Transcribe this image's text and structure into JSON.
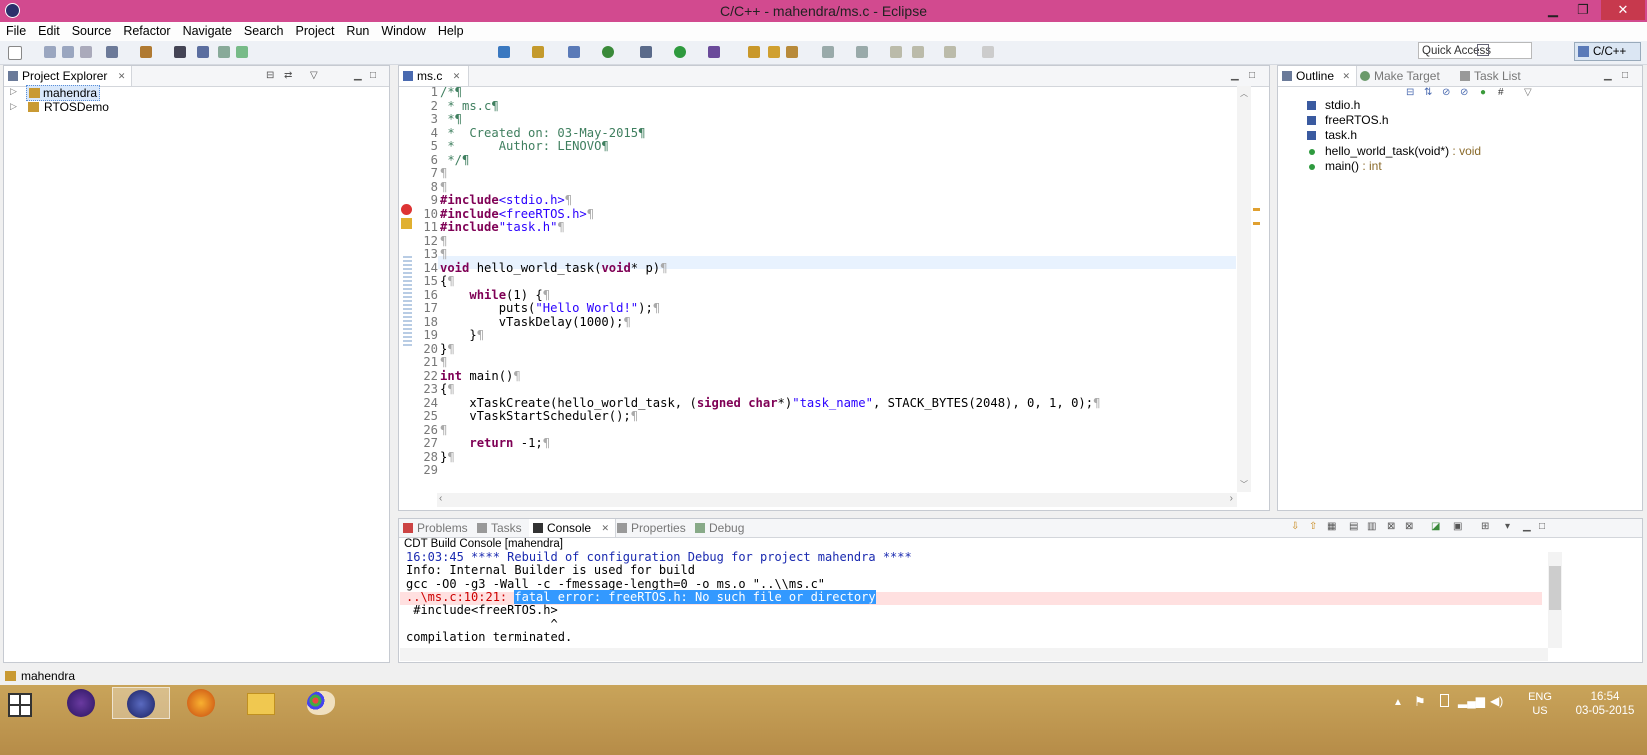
{
  "window": {
    "title": "C/C++ - mahendra/ms.c - Eclipse",
    "min": "▁",
    "max": "❐",
    "close": "✕"
  },
  "menu": [
    "File",
    "Edit",
    "Source",
    "Refactor",
    "Navigate",
    "Search",
    "Project",
    "Run",
    "Window",
    "Help"
  ],
  "toolbar": {
    "quick_access": "Quick Access",
    "perspective": "C/C++"
  },
  "project_explorer": {
    "tab": "Project Explorer",
    "items": [
      "mahendra",
      "RTOSDemo"
    ]
  },
  "editor": {
    "tab": "ms.c",
    "lines": [
      {
        "n": "1",
        "t": "/*¶",
        "c": "cmt"
      },
      {
        "n": "2",
        "t": " * ms.c¶",
        "c": "cmt"
      },
      {
        "n": "3",
        "t": " *¶",
        "c": "cmt"
      },
      {
        "n": "4",
        "t": " *  Created on: 03-May-2015¶",
        "c": "cmt"
      },
      {
        "n": "5",
        "t": " *      Author: LENOVO¶",
        "c": "cmt"
      },
      {
        "n": "6",
        "t": " */¶",
        "c": "cmt"
      },
      {
        "n": "7",
        "t": "¶",
        "c": "ws"
      },
      {
        "n": "8",
        "t": "¶",
        "c": "ws"
      },
      {
        "n": "9",
        "t": "#include<stdio.h>¶",
        "c": "inc"
      },
      {
        "n": "10",
        "t": "#include<freeRTOS.h>¶",
        "c": "inc"
      },
      {
        "n": "11",
        "t": "#include\"task.h\"¶",
        "c": "inc"
      },
      {
        "n": "12",
        "t": "¶",
        "c": "ws"
      },
      {
        "n": "13",
        "t": "¶",
        "c": "ws"
      },
      {
        "n": "14",
        "t": "void hello_world_task(void* p)¶",
        "c": "code"
      },
      {
        "n": "15",
        "t": "{¶",
        "c": "code"
      },
      {
        "n": "16",
        "t": "    while(1) {¶",
        "c": "code"
      },
      {
        "n": "17",
        "t": "        puts(\"Hello World!\");¶",
        "c": "code"
      },
      {
        "n": "18",
        "t": "        vTaskDelay(1000);¶",
        "c": "code"
      },
      {
        "n": "19",
        "t": "    }¶",
        "c": "code"
      },
      {
        "n": "20",
        "t": "}¶",
        "c": "code"
      },
      {
        "n": "21",
        "t": "¶",
        "c": "ws"
      },
      {
        "n": "22",
        "t": "int main()¶",
        "c": "code"
      },
      {
        "n": "23",
        "t": "{¶",
        "c": "code"
      },
      {
        "n": "24",
        "t": "    xTaskCreate(hello_world_task, (signed char*)\"task_name\", STACK_BYTES(2048), 0, 1, 0);¶",
        "c": "code"
      },
      {
        "n": "25",
        "t": "    vTaskStartScheduler();¶",
        "c": "code"
      },
      {
        "n": "26",
        "t": "¶",
        "c": "ws"
      },
      {
        "n": "27",
        "t": "    return -1;¶",
        "c": "code"
      },
      {
        "n": "28",
        "t": "}¶",
        "c": "code"
      },
      {
        "n": "29",
        "t": "",
        "c": "code"
      }
    ]
  },
  "outline": {
    "tabs": [
      "Outline",
      "Make Target",
      "Task List"
    ],
    "items": [
      {
        "label": "stdio.h",
        "type": ""
      },
      {
        "label": "freeRTOS.h",
        "type": ""
      },
      {
        "label": "task.h",
        "type": ""
      },
      {
        "label": "hello_world_task(void*)",
        "type": " : void"
      },
      {
        "label": "main()",
        "type": " : int"
      }
    ]
  },
  "bottom": {
    "tabs": [
      "Problems",
      "Tasks",
      "Console",
      "Properties",
      "Debug"
    ],
    "console_title": "CDT Build Console [mahendra]",
    "lines": [
      "16:03:45 **** Rebuild of configuration Debug for project mahendra ****",
      "Info: Internal Builder is used for build",
      "gcc -O0 -g3 -Wall -c -fmessage-length=0 -o ms.o \"..\\\\ms.c\"",
      "..\\ms.c:10:21: ",
      " #include<freeRTOS.h>",
      "                    ^",
      "compilation terminated."
    ],
    "error_highlight": "fatal error: freeRTOS.h: No such file or directory"
  },
  "status": {
    "project": "mahendra"
  },
  "taskbar": {
    "lang": "ENG",
    "region": "US",
    "time": "16:54",
    "date": "03-05-2015"
  },
  "colors": {
    "title_bar": "#d24a8f",
    "highlight": "#3399ff",
    "error_row": "#ffe0e0"
  }
}
